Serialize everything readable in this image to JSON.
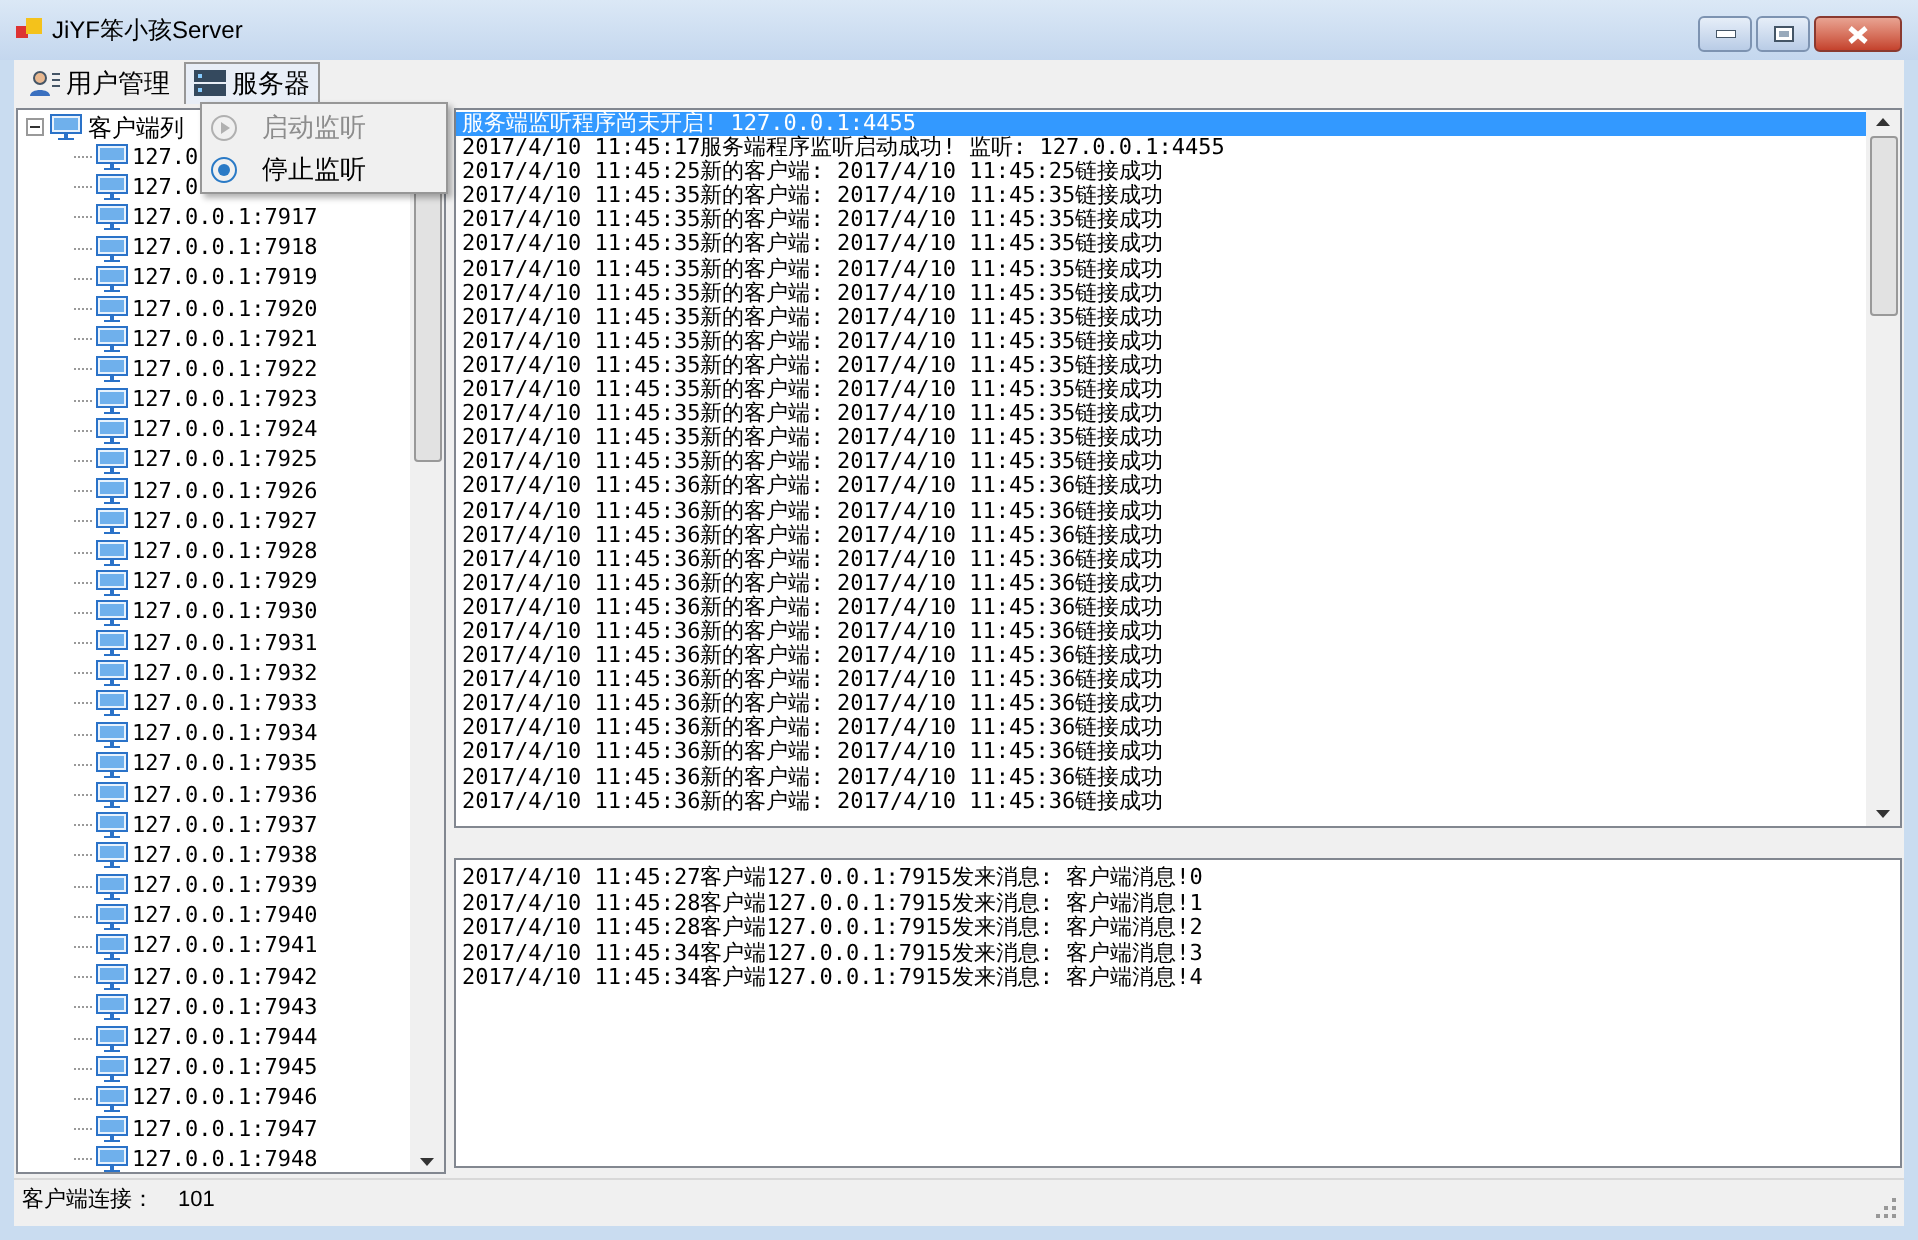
{
  "window": {
    "title": "JiYF笨小孩Server"
  },
  "menu_bar": [
    {
      "label": "用户管理",
      "selected": false,
      "kind": "users"
    },
    {
      "label": "服务器",
      "selected": true,
      "kind": "server"
    }
  ],
  "dropdown": [
    {
      "label": "启动监听",
      "disabled": true,
      "kind": "play"
    },
    {
      "label": "停止监听",
      "disabled": false,
      "kind": "radio"
    }
  ],
  "tree": {
    "label": "客户端列",
    "expanded": true,
    "children": [
      {
        "label": "127.0"
      },
      {
        "label": "127.0"
      },
      {
        "label": "127.0.0.1:7917"
      },
      {
        "label": "127.0.0.1:7918"
      },
      {
        "label": "127.0.0.1:7919"
      },
      {
        "label": "127.0.0.1:7920"
      },
      {
        "label": "127.0.0.1:7921"
      },
      {
        "label": "127.0.0.1:7922"
      },
      {
        "label": "127.0.0.1:7923"
      },
      {
        "label": "127.0.0.1:7924"
      },
      {
        "label": "127.0.0.1:7925"
      },
      {
        "label": "127.0.0.1:7926"
      },
      {
        "label": "127.0.0.1:7927"
      },
      {
        "label": "127.0.0.1:7928"
      },
      {
        "label": "127.0.0.1:7929"
      },
      {
        "label": "127.0.0.1:7930"
      },
      {
        "label": "127.0.0.1:7931"
      },
      {
        "label": "127.0.0.1:7932"
      },
      {
        "label": "127.0.0.1:7933"
      },
      {
        "label": "127.0.0.1:7934"
      },
      {
        "label": "127.0.0.1:7935"
      },
      {
        "label": "127.0.0.1:7936"
      },
      {
        "label": "127.0.0.1:7937"
      },
      {
        "label": "127.0.0.1:7938"
      },
      {
        "label": "127.0.0.1:7939"
      },
      {
        "label": "127.0.0.1:7940"
      },
      {
        "label": "127.0.0.1:7941"
      },
      {
        "label": "127.0.0.1:7942"
      },
      {
        "label": "127.0.0.1:7943"
      },
      {
        "label": "127.0.0.1:7944"
      },
      {
        "label": "127.0.0.1:7945"
      },
      {
        "label": "127.0.0.1:7946"
      },
      {
        "label": "127.0.0.1:7947"
      },
      {
        "label": "127.0.0.1:7948"
      }
    ]
  },
  "log": [
    {
      "text": "服务端监听程序尚未开启! 127.0.0.1:4455",
      "selected": true
    },
    {
      "text": "2017/4/10 11:45:17服务端程序监听启动成功! 监听: 127.0.0.1:4455",
      "selected": false
    },
    {
      "text": "2017/4/10 11:45:25新的客户端: 2017/4/10 11:45:25链接成功",
      "selected": false
    },
    {
      "text": "2017/4/10 11:45:35新的客户端: 2017/4/10 11:45:35链接成功",
      "selected": false
    },
    {
      "text": "2017/4/10 11:45:35新的客户端: 2017/4/10 11:45:35链接成功",
      "selected": false
    },
    {
      "text": "2017/4/10 11:45:35新的客户端: 2017/4/10 11:45:35链接成功",
      "selected": false
    },
    {
      "text": "2017/4/10 11:45:35新的客户端: 2017/4/10 11:45:35链接成功",
      "selected": false
    },
    {
      "text": "2017/4/10 11:45:35新的客户端: 2017/4/10 11:45:35链接成功",
      "selected": false
    },
    {
      "text": "2017/4/10 11:45:35新的客户端: 2017/4/10 11:45:35链接成功",
      "selected": false
    },
    {
      "text": "2017/4/10 11:45:35新的客户端: 2017/4/10 11:45:35链接成功",
      "selected": false
    },
    {
      "text": "2017/4/10 11:45:35新的客户端: 2017/4/10 11:45:35链接成功",
      "selected": false
    },
    {
      "text": "2017/4/10 11:45:35新的客户端: 2017/4/10 11:45:35链接成功",
      "selected": false
    },
    {
      "text": "2017/4/10 11:45:35新的客户端: 2017/4/10 11:45:35链接成功",
      "selected": false
    },
    {
      "text": "2017/4/10 11:45:35新的客户端: 2017/4/10 11:45:35链接成功",
      "selected": false
    },
    {
      "text": "2017/4/10 11:45:35新的客户端: 2017/4/10 11:45:35链接成功",
      "selected": false
    },
    {
      "text": "2017/4/10 11:45:36新的客户端: 2017/4/10 11:45:36链接成功",
      "selected": false
    },
    {
      "text": "2017/4/10 11:45:36新的客户端: 2017/4/10 11:45:36链接成功",
      "selected": false
    },
    {
      "text": "2017/4/10 11:45:36新的客户端: 2017/4/10 11:45:36链接成功",
      "selected": false
    },
    {
      "text": "2017/4/10 11:45:36新的客户端: 2017/4/10 11:45:36链接成功",
      "selected": false
    },
    {
      "text": "2017/4/10 11:45:36新的客户端: 2017/4/10 11:45:36链接成功",
      "selected": false
    },
    {
      "text": "2017/4/10 11:45:36新的客户端: 2017/4/10 11:45:36链接成功",
      "selected": false
    },
    {
      "text": "2017/4/10 11:45:36新的客户端: 2017/4/10 11:45:36链接成功",
      "selected": false
    },
    {
      "text": "2017/4/10 11:45:36新的客户端: 2017/4/10 11:45:36链接成功",
      "selected": false
    },
    {
      "text": "2017/4/10 11:45:36新的客户端: 2017/4/10 11:45:36链接成功",
      "selected": false
    },
    {
      "text": "2017/4/10 11:45:36新的客户端: 2017/4/10 11:45:36链接成功",
      "selected": false
    },
    {
      "text": "2017/4/10 11:45:36新的客户端: 2017/4/10 11:45:36链接成功",
      "selected": false
    },
    {
      "text": "2017/4/10 11:45:36新的客户端: 2017/4/10 11:45:36链接成功",
      "selected": false
    },
    {
      "text": "2017/4/10 11:45:36新的客户端: 2017/4/10 11:45:36链接成功",
      "selected": false
    },
    {
      "text": "2017/4/10 11:45:36新的客户端: 2017/4/10 11:45:36链接成功",
      "selected": false
    }
  ],
  "messages": [
    "2017/4/10 11:45:27客户端127.0.0.1:7915发来消息: 客户端消息!0",
    "2017/4/10 11:45:28客户端127.0.0.1:7915发来消息: 客户端消息!1",
    "2017/4/10 11:45:28客户端127.0.0.1:7915发来消息: 客户端消息!2",
    "2017/4/10 11:45:34客户端127.0.0.1:7915发来消息: 客户端消息!3",
    "2017/4/10 11:45:34客户端127.0.0.1:7915发来消息: 客户端消息!4"
  ],
  "status_bar": {
    "label": "客户端连接：",
    "value": "101"
  }
}
